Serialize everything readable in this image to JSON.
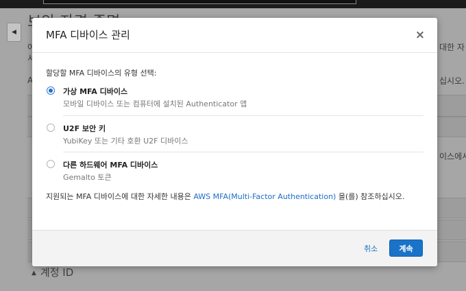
{
  "background": {
    "title": "보안 자격 증명",
    "side_text_1": "대한 자",
    "side_text_2": "십시오.",
    "side_text_3": "이스에서",
    "left_letter_o": "어",
    "left_letter_s": "서",
    "left_letter_a": "A",
    "account_section": "계정 ID"
  },
  "modal": {
    "title": "MFA 디바이스 관리",
    "close_label": "×",
    "prompt": "할당할 MFA 디바이스의 유형 선택:",
    "options": [
      {
        "label": "가상 MFA 디바이스",
        "desc": "모바일 디바이스 또는 컴퓨터에 설치된 Authenticator 앱",
        "selected": true
      },
      {
        "label": "U2F 보안 키",
        "desc": "YubiKey 또는 기타 호환 U2F 디바이스",
        "selected": false
      },
      {
        "label": "다른 하드웨어 MFA 디바이스",
        "desc": "Gemalto 토큰",
        "selected": false
      }
    ],
    "info_prefix": "지원되는 MFA 디바이스에 대한 자세한 내용은 ",
    "info_link": "AWS MFA(Multi-Factor Authentication)",
    "info_suffix": " 을(를) 참조하십시오.",
    "cancel_label": "취소",
    "continue_label": "계속"
  },
  "colors": {
    "primary": "#1a73c9",
    "link": "#1b6cc6",
    "overlay": "#a6a6a6"
  }
}
